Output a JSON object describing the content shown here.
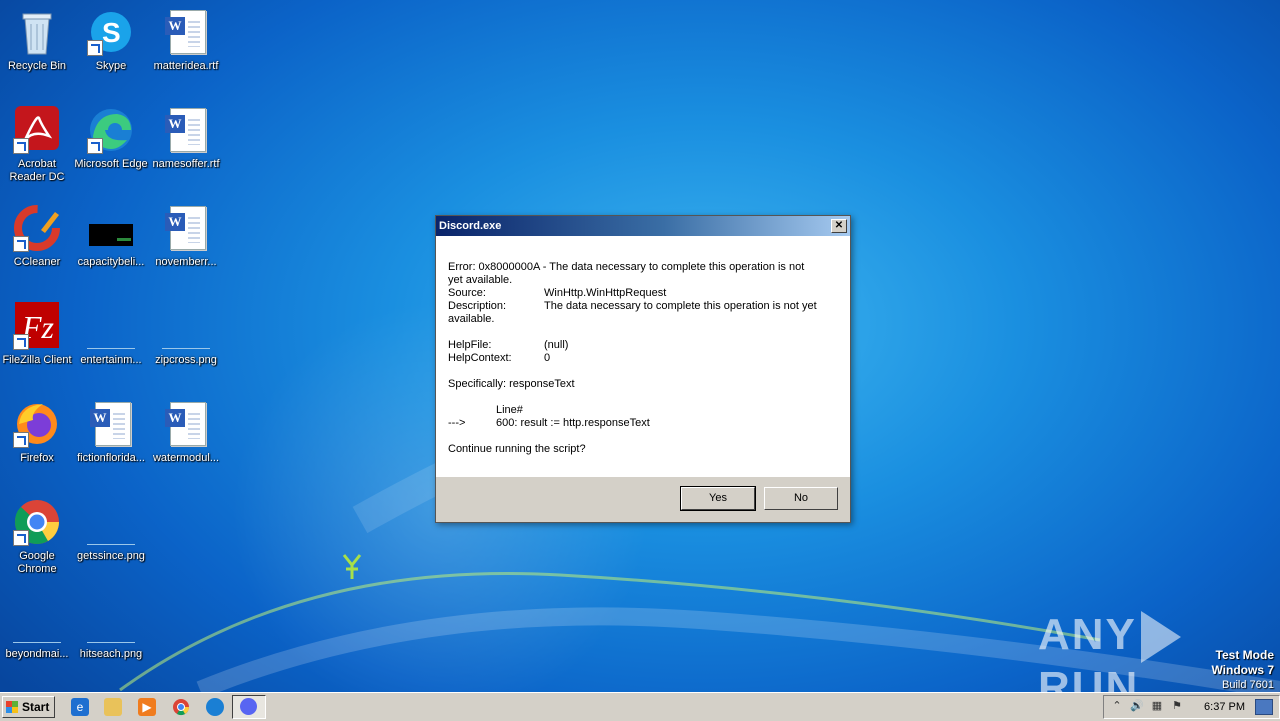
{
  "desktop": {
    "icons": [
      {
        "label": "Recycle Bin",
        "icon": "recycle-bin-icon"
      },
      {
        "label": "Skype",
        "icon": "skype-icon"
      },
      {
        "label": "matteridea.rtf",
        "icon": "word-document-icon"
      },
      {
        "label": "Acrobat Reader DC",
        "icon": "acrobat-icon"
      },
      {
        "label": "Microsoft Edge",
        "icon": "edge-icon"
      },
      {
        "label": "namesoffer.rtf",
        "icon": "word-document-icon"
      },
      {
        "label": "CCleaner",
        "icon": "ccleaner-icon"
      },
      {
        "label": "capacitybeli...",
        "icon": "image-file-icon"
      },
      {
        "label": "novemberr...",
        "icon": "word-document-icon"
      },
      {
        "label": "FileZilla Client",
        "icon": "filezilla-icon"
      },
      {
        "label": "entertainm...",
        "icon": "image-file-icon"
      },
      {
        "label": "zipcross.png",
        "icon": "image-file-icon"
      },
      {
        "label": "Firefox",
        "icon": "firefox-icon"
      },
      {
        "label": "fictionflorida...",
        "icon": "word-document-icon"
      },
      {
        "label": "watermodul...",
        "icon": "word-document-icon"
      },
      {
        "label": "Google Chrome",
        "icon": "chrome-icon"
      },
      {
        "label": "getssince.png",
        "icon": "image-file-icon"
      },
      {
        "label": "beyondmai...",
        "icon": "image-file-icon"
      },
      {
        "label": "hitseach.png",
        "icon": "image-file-icon"
      }
    ]
  },
  "dialog": {
    "title": "Discord.exe",
    "error_line1": "Error:  0x8000000A - The data necessary to complete this operation is not",
    "error_line2": "yet available.",
    "source_label": "Source:",
    "source_value": "WinHttp.WinHttpRequest",
    "description_label": "Description:",
    "description_value": "The data necessary to complete this operation is not yet",
    "description_cont": "available.",
    "helpfile_label": "HelpFile:",
    "helpfile_value": "(null)",
    "helpcontext_label": "HelpContext:",
    "helpcontext_value": "0",
    "specifically": "Specifically: responseText",
    "line_header": "Line#",
    "arrow": "--->",
    "line_code": "600: result := http.responseText",
    "prompt": "Continue running the script?",
    "yes_label": "Yes",
    "no_label": "No",
    "close_glyph": "✕"
  },
  "taskbar": {
    "start_label": "Start",
    "clock": "6:37 PM"
  },
  "watermark": {
    "text_left": "ANY",
    "text_right": "RUN",
    "test_mode": "Test Mode",
    "os": "Windows 7",
    "build": "Build 7601"
  }
}
